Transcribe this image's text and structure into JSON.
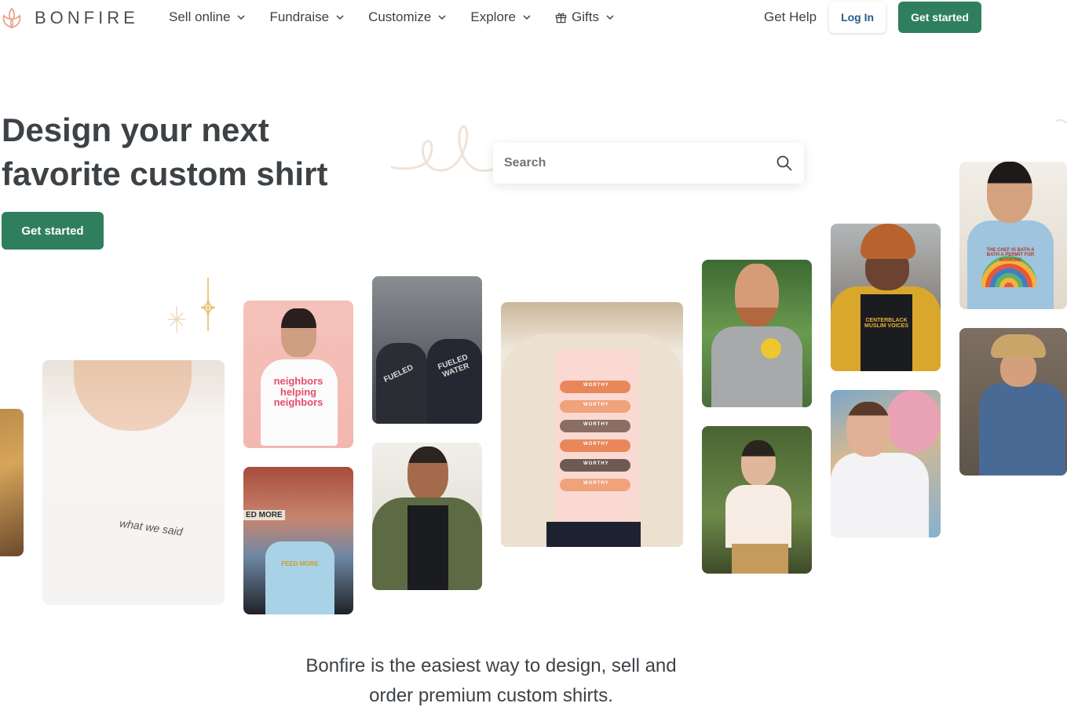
{
  "brand": {
    "name": "BONFIRE",
    "accent_color": "#2f7f5f",
    "logo_color": "#e6a28a"
  },
  "nav": {
    "items": [
      {
        "label": "Sell online",
        "icon": "chevron-down-icon"
      },
      {
        "label": "Fundraise",
        "icon": "chevron-down-icon"
      },
      {
        "label": "Customize",
        "icon": "chevron-down-icon"
      },
      {
        "label": "Explore",
        "icon": "chevron-down-icon"
      },
      {
        "label": "Gifts",
        "icon": "chevron-down-icon",
        "leading_icon": "gift-icon"
      }
    ],
    "help_label": "Get Help",
    "login_label": "Log In",
    "cta_label": "Get started"
  },
  "hero": {
    "title_line1": "Design your next",
    "title_line2": "favorite custom shirt",
    "cta_label": "Get started",
    "search_placeholder": "Search",
    "search_icon": "search-icon"
  },
  "photos": {
    "p1_text": "what we said",
    "p2_text": "neighbors helping neighbors",
    "p3_text_left": "FUELED",
    "p3_text_right": "FUELED WATER",
    "p4_sign": "ED MORE",
    "p4_text": "FEED MORE",
    "p9_text": "CENTERBLACK MUSLIM VOICES",
    "p11_text": "THE CHEF IS BATH A BATH A PERMIT FOR MANKIND",
    "p6_words": [
      "WORTHY",
      "WORTHY",
      "WORTHY",
      "WORTHY",
      "WORTHY",
      "WORTHY"
    ]
  },
  "tagline": {
    "line1": "Bonfire is the easiest way to design, sell and",
    "line2": "order premium custom shirts."
  }
}
